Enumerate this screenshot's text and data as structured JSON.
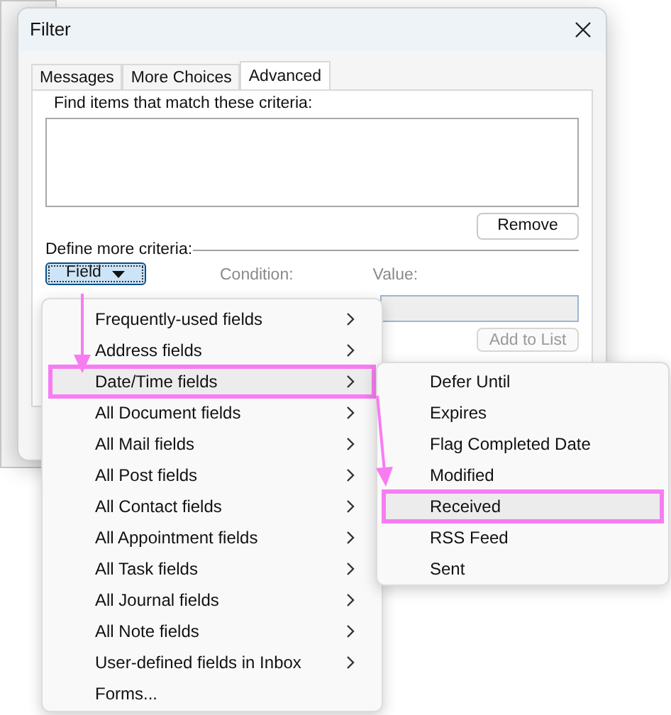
{
  "window": {
    "title": "Filter"
  },
  "tabs": [
    {
      "label": "Messages",
      "selected": false
    },
    {
      "label": "More Choices",
      "selected": false
    },
    {
      "label": "Advanced",
      "selected": true
    }
  ],
  "criteria_label": "Find items that match these criteria:",
  "remove_button": "Remove",
  "define_label": "Define more criteria:",
  "field_button": "Field",
  "condition_label": "Condition:",
  "value_label": "Value:",
  "value_field": {
    "disabled": true
  },
  "add_button": {
    "label": "Add to List",
    "disabled": true
  },
  "field_menu": {
    "items": [
      {
        "label": "Frequently-used fields",
        "kind": "submenu",
        "selected": false
      },
      {
        "label": "Address fields",
        "kind": "submenu",
        "selected": false
      },
      {
        "label": "Date/Time fields",
        "kind": "submenu",
        "selected": true
      },
      {
        "label": "All Document fields",
        "kind": "submenu",
        "selected": false
      },
      {
        "label": "All Mail fields",
        "kind": "submenu",
        "selected": false
      },
      {
        "label": "All Post fields",
        "kind": "submenu",
        "selected": false
      },
      {
        "label": "All Contact fields",
        "kind": "submenu",
        "selected": false
      },
      {
        "label": "All Appointment fields",
        "kind": "submenu",
        "selected": false
      },
      {
        "label": "All Task fields",
        "kind": "submenu",
        "selected": false
      },
      {
        "label": "All Journal fields",
        "kind": "submenu",
        "selected": false
      },
      {
        "label": "All Note fields",
        "kind": "submenu",
        "selected": false
      },
      {
        "label": "User-defined fields in Inbox",
        "kind": "submenu",
        "selected": false
      },
      {
        "label": "Forms...",
        "kind": "command",
        "selected": false
      }
    ]
  },
  "submenu": {
    "items": [
      {
        "label": "Defer Until",
        "selected": false
      },
      {
        "label": "Expires",
        "selected": false
      },
      {
        "label": "Flag Completed Date",
        "selected": false
      },
      {
        "label": "Modified",
        "selected": false
      },
      {
        "label": "Received",
        "selected": true
      },
      {
        "label": "RSS Feed",
        "selected": false
      },
      {
        "label": "Sent",
        "selected": false
      }
    ]
  }
}
